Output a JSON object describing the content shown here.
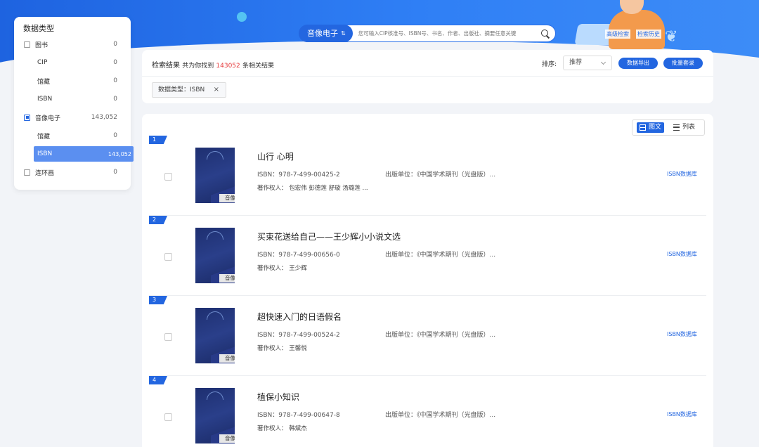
{
  "colors": {
    "accent": "#2366e0",
    "highlight_number": "#e6393b",
    "banner": "#2f7ff5"
  },
  "search": {
    "type_label": "音像电子",
    "type_swap_icon": "⇅",
    "placeholder": "您可输入CIP核准号、ISBN号、书名、作者、出版社、摘要任意关键",
    "icon": "search-icon"
  },
  "top_links": {
    "advanced": "高级检索",
    "history": "检索历史"
  },
  "sidebar": {
    "title": "数据类型",
    "rows": [
      {
        "label": "图书",
        "count": "0",
        "checked": false
      },
      {
        "label": "CIP",
        "count": "0"
      },
      {
        "label": "馆藏",
        "count": "0"
      },
      {
        "label": "ISBN",
        "count": "0"
      },
      {
        "label": "音像电子",
        "count": "143,052",
        "checked": true
      },
      {
        "label": "馆藏",
        "count": "0"
      },
      {
        "label": "ISBN",
        "count": "143,052",
        "active": true
      },
      {
        "label": "连环画",
        "count": "0",
        "checked": false
      }
    ]
  },
  "results": {
    "title": "检索结果",
    "prefix": "共为你找到",
    "count": "143052",
    "suffix": "条相关结果",
    "sort_label": "排序:",
    "sort_value": "推荐",
    "export_button": "数据导出",
    "batch_button": "批量套录",
    "filter_tag": "数据类型：ISBN",
    "filter_close": "×"
  },
  "view_toggle": {
    "grid": "图文",
    "list": "列表"
  },
  "cover_tag": "音像电子",
  "items": [
    {
      "index": "1",
      "title": "山行 心明",
      "isbn": "ISBN：978-7-499-00425-2",
      "publisher": "出版单位：《中国学术期刊（光盘版）...",
      "author": "著作权人：  包宏伟 彭德莲 舒璇 汤璐莲 ...",
      "link": "ISBN数据库"
    },
    {
      "index": "2",
      "title": "买束花送给自己——王少辉小小说文选",
      "isbn": "ISBN：978-7-499-00656-0",
      "publisher": "出版单位：《中国学术期刊（光盘版）...",
      "author": "著作权人：  王少辉",
      "link": "ISBN数据库"
    },
    {
      "index": "3",
      "title": "超快速入门的日语假名",
      "isbn": "ISBN：978-7-499-00524-2",
      "publisher": "出版单位：《中国学术期刊（光盘版）...",
      "author": "著作权人：  王馨悦",
      "link": "ISBN数据库"
    },
    {
      "index": "4",
      "title": "植保小知识",
      "isbn": "ISBN：978-7-499-00647-8",
      "publisher": "出版单位：《中国学术期刊（光盘版）...",
      "author": "著作权人：  韩斌杰",
      "link": "ISBN数据库"
    }
  ]
}
